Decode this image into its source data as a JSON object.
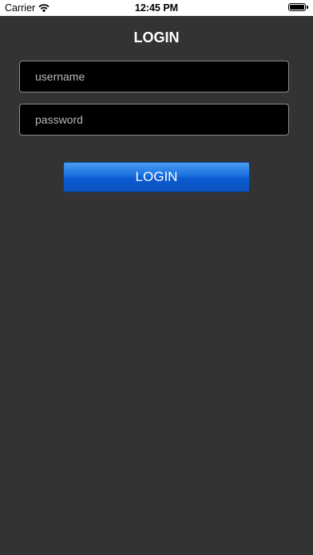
{
  "status_bar": {
    "carrier": "Carrier",
    "time": "12:45 PM",
    "wifi_icon": "wifi-icon",
    "battery_icon": "battery-icon"
  },
  "login_screen": {
    "title": "LOGIN",
    "username_placeholder": "username",
    "username_value": "",
    "password_placeholder": "password",
    "password_value": "",
    "login_button_label": "LOGIN"
  },
  "colors": {
    "background": "#333333",
    "field_background": "#000000",
    "field_border": "#8a8a8a",
    "button_blue": "#1a6fe0",
    "text": "#ffffff"
  }
}
